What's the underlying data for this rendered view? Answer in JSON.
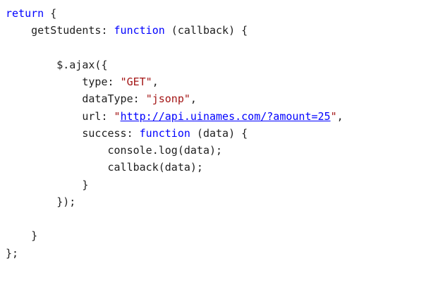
{
  "colors": {
    "background": "#ffffff",
    "text": "#1e1e1e",
    "keyword": "#0000ff",
    "string": "#a31515",
    "link": "#0000ff"
  },
  "code": {
    "lines": [
      [
        {
          "t": "kw",
          "v": "return"
        },
        {
          "t": "plain",
          "v": " {"
        }
      ],
      [
        {
          "t": "plain",
          "v": "    getStudents: "
        },
        {
          "t": "kw",
          "v": "function"
        },
        {
          "t": "plain",
          "v": " (callback) {"
        }
      ],
      [],
      [
        {
          "t": "plain",
          "v": "        $.ajax({"
        }
      ],
      [
        {
          "t": "plain",
          "v": "            type: "
        },
        {
          "t": "str",
          "v": "\"GET\""
        },
        {
          "t": "plain",
          "v": ","
        }
      ],
      [
        {
          "t": "plain",
          "v": "            dataType: "
        },
        {
          "t": "str",
          "v": "\"jsonp\""
        },
        {
          "t": "plain",
          "v": ","
        }
      ],
      [
        {
          "t": "plain",
          "v": "            url: "
        },
        {
          "t": "str",
          "v": "\""
        },
        {
          "t": "link",
          "v": "http://api.uinames.com/?amount=25"
        },
        {
          "t": "str",
          "v": "\""
        },
        {
          "t": "plain",
          "v": ","
        }
      ],
      [
        {
          "t": "plain",
          "v": "            success: "
        },
        {
          "t": "kw",
          "v": "function"
        },
        {
          "t": "plain",
          "v": " (data) {"
        }
      ],
      [
        {
          "t": "plain",
          "v": "                console.log(data);"
        }
      ],
      [
        {
          "t": "plain",
          "v": "                callback(data);"
        }
      ],
      [
        {
          "t": "plain",
          "v": "            }"
        }
      ],
      [
        {
          "t": "plain",
          "v": "        });"
        }
      ],
      [],
      [
        {
          "t": "plain",
          "v": "    }"
        }
      ],
      [
        {
          "t": "plain",
          "v": "};"
        }
      ]
    ]
  }
}
